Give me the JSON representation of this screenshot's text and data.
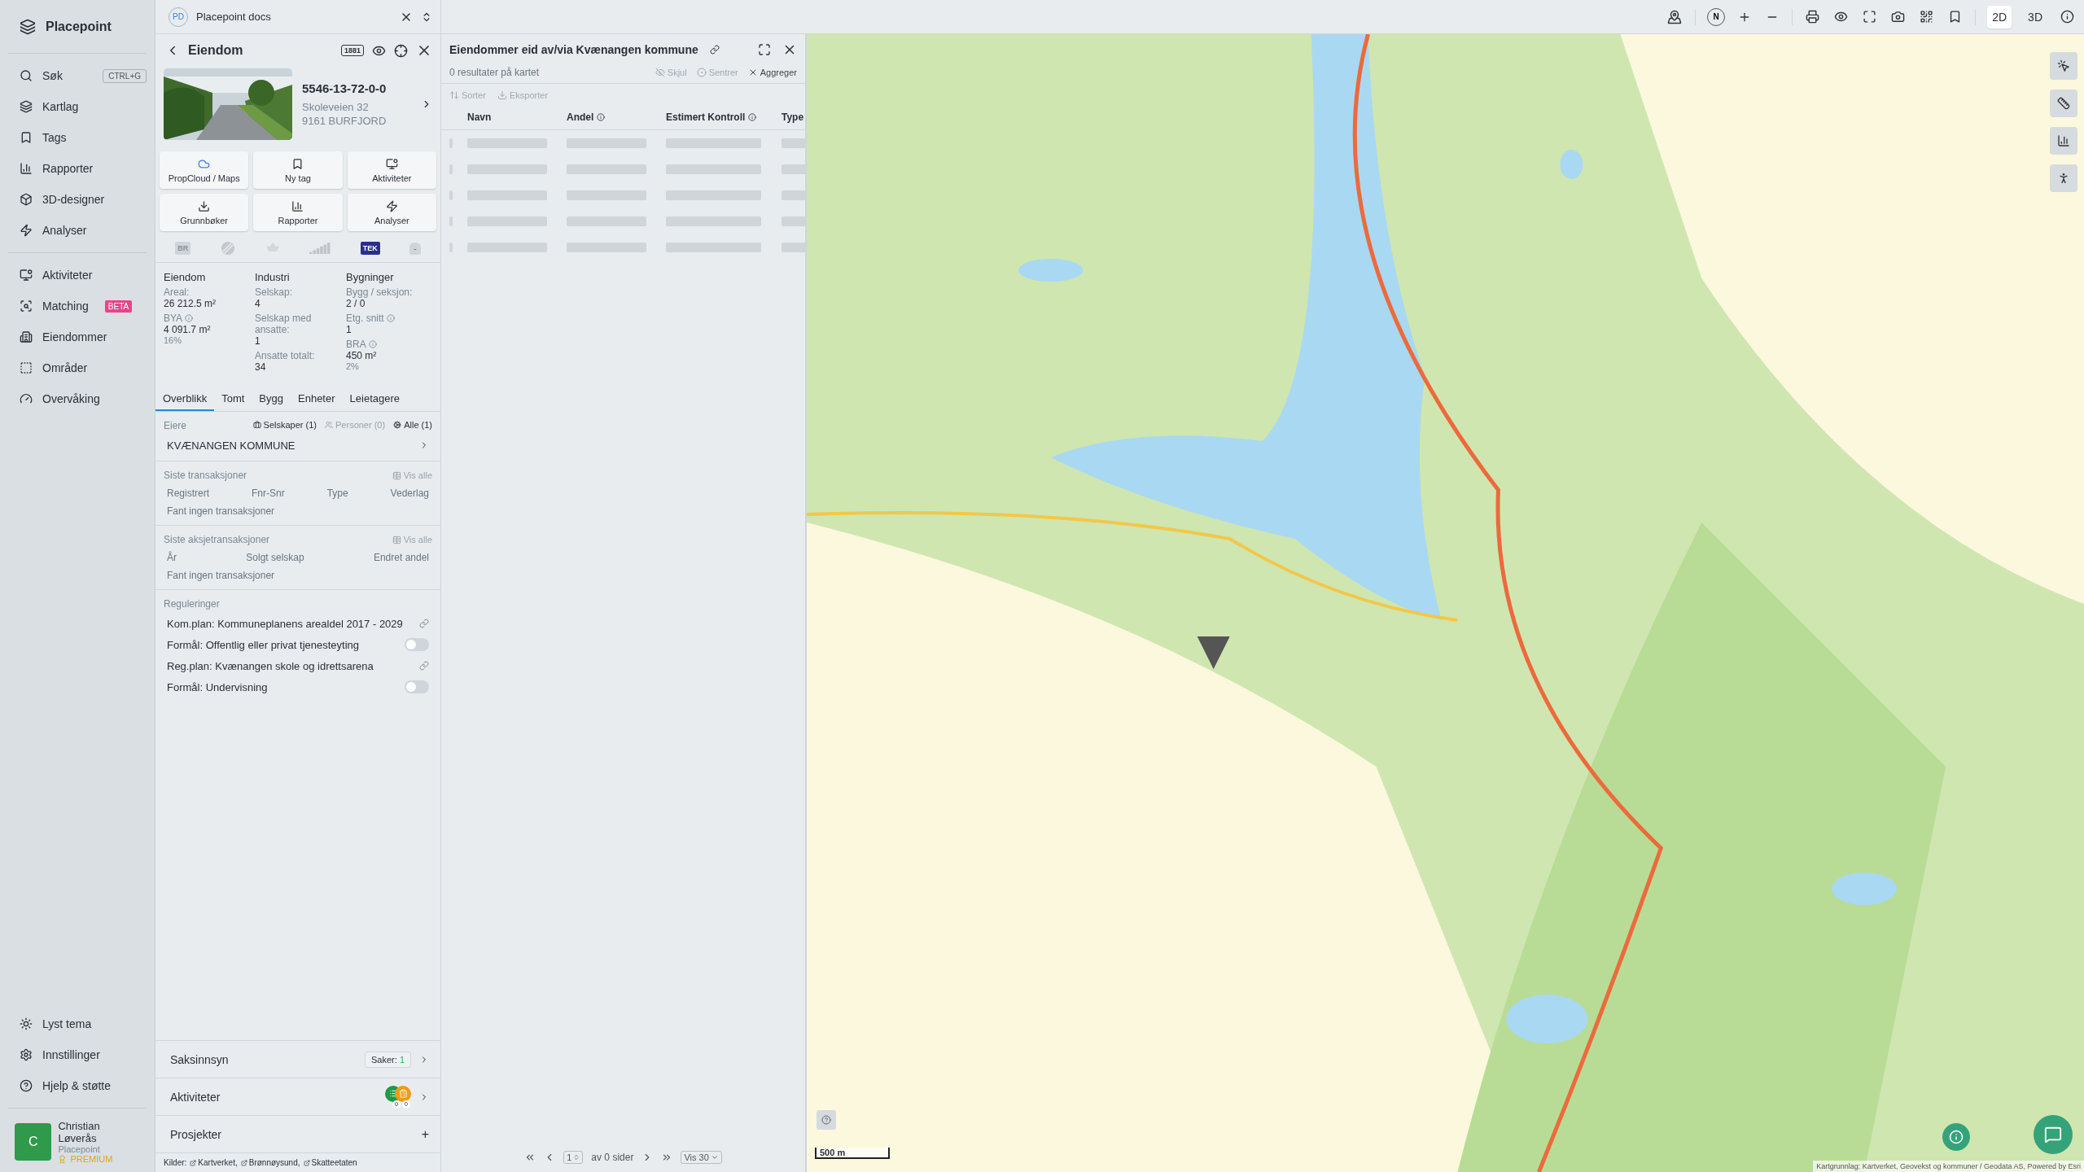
{
  "app": {
    "name": "Placepoint"
  },
  "nav_main": [
    {
      "label": "Søk",
      "shortcut": "CTRL+G"
    },
    {
      "label": "Kartlag"
    },
    {
      "label": "Tags"
    },
    {
      "label": "Rapporter"
    },
    {
      "label": "3D-designer"
    },
    {
      "label": "Analyser"
    }
  ],
  "nav_tools": [
    {
      "label": "Aktiviteter"
    },
    {
      "label": "Matching",
      "badge": "BETA"
    },
    {
      "label": "Eiendommer"
    },
    {
      "label": "Områder"
    },
    {
      "label": "Overvåking"
    }
  ],
  "nav_bottom": [
    {
      "label": "Lyst tema"
    },
    {
      "label": "Innstillinger"
    },
    {
      "label": "Hjelp & støtte"
    }
  ],
  "user": {
    "initial": "C",
    "name": "Christian Løverås",
    "org": "Placepoint",
    "plan": "PREMIUM"
  },
  "workspace": {
    "badge": "PD",
    "name": "Placepoint docs"
  },
  "property": {
    "title": "Eiendom",
    "phone_badge": "1881",
    "id": "5546-13-72-0-0",
    "address": "Skoleveien 32",
    "postal": "9161 BURFJORD",
    "actions": [
      {
        "label": "PropCloud / Maps"
      },
      {
        "label": "Ny tag"
      },
      {
        "label": "Aktiviteter"
      },
      {
        "label": "Grunnbøker"
      },
      {
        "label": "Rapporter"
      },
      {
        "label": "Analyser"
      }
    ],
    "sources_logos": [
      {
        "kind": "badge",
        "text": "BR"
      },
      {
        "kind": "globe"
      },
      {
        "kind": "leaf"
      },
      {
        "kind": "bars"
      },
      {
        "kind": "tek",
        "text": "TEK"
      },
      {
        "kind": "house",
        "text": "-"
      }
    ],
    "stats": [
      {
        "heading": "Eiendom",
        "items": [
          {
            "label": "Areal:",
            "value": "26 212.5",
            "unit": "m²"
          },
          {
            "label": "BYA",
            "info": true,
            "value": "4 091.7",
            "unit": "m²",
            "sub": "16%"
          }
        ]
      },
      {
        "heading": "Industri",
        "items": [
          {
            "label": "Selskap:",
            "value": "4"
          },
          {
            "label": "Selskap med ansatte:",
            "value": "1"
          },
          {
            "label": "Ansatte totalt:",
            "value": "34"
          }
        ]
      },
      {
        "heading": "Bygninger",
        "items": [
          {
            "label": "Bygg / seksjon:",
            "value": "2 / 0"
          },
          {
            "label": "Etg. snitt",
            "info": true,
            "value": "1"
          },
          {
            "label": "BRA",
            "info": true,
            "value": "450",
            "unit": "m²",
            "sub": "2%"
          }
        ]
      }
    ],
    "tabs": [
      {
        "label": "Overblikk",
        "selected": true
      },
      {
        "label": "Tomt",
        "selected": false
      },
      {
        "label": "Bygg",
        "selected": false
      },
      {
        "label": "Enheter",
        "selected": false
      },
      {
        "label": "Leietagere",
        "selected": false
      }
    ],
    "owners": {
      "label": "Eiere",
      "filters": [
        {
          "label": "Selskaper (1)",
          "disabled": false
        },
        {
          "label": "Personer (0)",
          "disabled": true
        },
        {
          "label": "Alle (1)",
          "disabled": false
        }
      ],
      "name": "KVÆNANGEN KOMMUNE"
    },
    "transactions": {
      "title": "Siste transaksjoner",
      "link": "Vis alle",
      "columns": [
        "Registrert",
        "Fnr-Snr",
        "Type",
        "Vederlag"
      ],
      "empty": "Fant ingen transaksjoner"
    },
    "share_transactions": {
      "title": "Siste aksjetransaksjoner",
      "link": "Vis alle",
      "columns": [
        "År",
        "Solgt selskap",
        "Endret andel"
      ],
      "empty": "Fant ingen transaksjoner"
    },
    "regulations": {
      "title": "Reguleringer",
      "items": [
        {
          "kind": "link",
          "text": "Kom.plan: Kommuneplanens arealdel 2017 - 2029"
        },
        {
          "kind": "toggle",
          "text": "Formål: Offentlig eller privat tjenesteyting",
          "on": false
        },
        {
          "kind": "link",
          "text": "Reg.plan: Kvænangen skole og idrettsarena"
        },
        {
          "kind": "toggle",
          "text": "Formål: Undervisning",
          "on": false
        }
      ]
    },
    "sections": [
      {
        "kind": "cases",
        "label": "Saksinnsyn",
        "badge_label": "Saker:",
        "badge_value": "1"
      },
      {
        "kind": "activities",
        "label": "Aktiviteter",
        "counts": [
          "0",
          "0"
        ]
      },
      {
        "kind": "add",
        "label": "Prosjekter",
        "symbol": "+"
      }
    ],
    "sources": {
      "label": "Kilder:",
      "items": [
        "Kartverket,",
        "Brønnøysund,",
        "Skatteetaten"
      ]
    }
  },
  "results": {
    "title": "Eiendommer eid av/via Kvænangen kommune",
    "count": "0 resultater på kartet",
    "actions": [
      {
        "label": "Skjul",
        "disabled": true
      },
      {
        "label": "Sentrer",
        "disabled": true
      },
      {
        "label": "Aggreger",
        "disabled": false
      }
    ],
    "tools": [
      {
        "label": "Sorter",
        "disabled": true
      },
      {
        "label": "Eksporter",
        "disabled": true
      }
    ],
    "columns": [
      {
        "label": "Navn"
      },
      {
        "label": "Andel",
        "info": true
      },
      {
        "label": "Estimert Kontroll",
        "info": true
      },
      {
        "label": "Type"
      }
    ],
    "pagination": {
      "page": "1",
      "of": "av 0 sider",
      "per_page": "Vis 30"
    }
  },
  "map_toolbar": {
    "compass": "N",
    "modes": [
      {
        "label": "2D",
        "selected": true
      },
      {
        "label": "3D",
        "selected": false
      }
    ]
  },
  "map": {
    "scale": "500 m",
    "attribution": "Kartgrunnlag: Kartverket, Geovekst og kommuner / Geodata AS, Powered by Esri"
  }
}
